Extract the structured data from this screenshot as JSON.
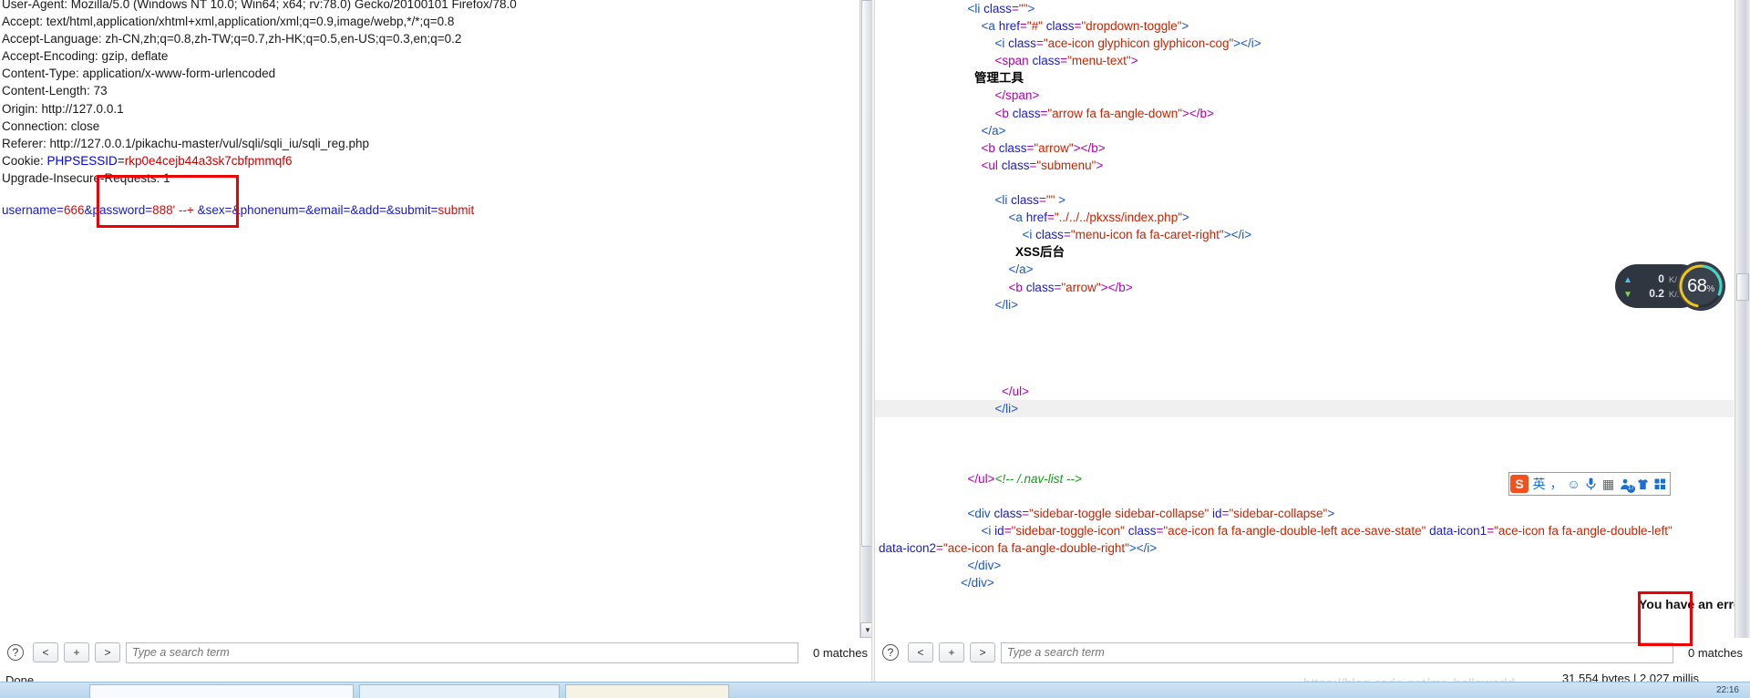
{
  "request": {
    "headers": [
      "User-Agent: Mozilla/5.0 (Windows NT 10.0; Win64; x64; rv:78.0) Gecko/20100101 Firefox/78.0",
      "Accept: text/html,application/xhtml+xml,application/xml;q=0.9,image/webp,*/*;q=0.8",
      "Accept-Language: zh-CN,zh;q=0.8,zh-TW;q=0.7,zh-HK;q=0.5,en-US;q=0.3,en;q=0.2",
      "Accept-Encoding: gzip, deflate",
      "Content-Type: application/x-www-form-urlencoded",
      "Content-Length: 73",
      "Origin: http://127.0.0.1",
      "Connection: close",
      "Referer: http://127.0.0.1/pikachu-master/vul/sqli/sqli_iu/sqli_reg.php"
    ],
    "cookie_label": "Cookie: ",
    "cookie_name": "PHPSESSID",
    "cookie_eq": "=",
    "cookie_value": "rkp0e4cejb44a3sk7cbfpmmqf6",
    "upgrade_header": "Upgrade-Insecure-Requests: 1",
    "post_body": [
      {
        "text": "username",
        "color": "blue"
      },
      {
        "text": "=",
        "color": "blue"
      },
      {
        "text": "666",
        "color": "red"
      },
      {
        "text": "&",
        "color": "blue"
      },
      {
        "text": "password",
        "color": "blue"
      },
      {
        "text": "=",
        "color": "blue"
      },
      {
        "text": "888' --+ ",
        "color": "red"
      },
      {
        "text": "&",
        "color": "blue"
      },
      {
        "text": "sex",
        "color": "blue"
      },
      {
        "text": "=&",
        "color": "blue"
      },
      {
        "text": "phonenum",
        "color": "blue"
      },
      {
        "text": "=&",
        "color": "blue"
      },
      {
        "text": "email",
        "color": "blue"
      },
      {
        "text": "=&",
        "color": "blue"
      },
      {
        "text": "add",
        "color": "blue"
      },
      {
        "text": "=&",
        "color": "blue"
      },
      {
        "text": "submit",
        "color": "blue"
      },
      {
        "text": "=",
        "color": "blue"
      },
      {
        "text": "submit",
        "color": "red"
      }
    ],
    "status": "Done",
    "search": {
      "placeholder": "Type a search term",
      "value": "",
      "matches": "0 matches",
      "help": "?",
      "prev": "<",
      "add": "+",
      "next": ">"
    }
  },
  "response": {
    "code_lines": [
      {
        "indent": 13,
        "shaded": false,
        "tokens": [
          {
            "t": "<li ",
            "c": "tag"
          },
          {
            "t": "class",
            "c": "attr"
          },
          {
            "t": "=",
            "c": "punct"
          },
          {
            "t": "\"\"",
            "c": "val"
          },
          {
            "t": ">",
            "c": "tag"
          }
        ]
      },
      {
        "indent": 15,
        "shaded": false,
        "tokens": [
          {
            "t": "<a ",
            "c": "tag"
          },
          {
            "t": "href",
            "c": "attr"
          },
          {
            "t": "=",
            "c": "punct"
          },
          {
            "t": "\"#\"",
            "c": "val"
          },
          {
            "t": " class",
            "c": "attr"
          },
          {
            "t": "=",
            "c": "punct"
          },
          {
            "t": "\"dropdown-toggle\"",
            "c": "val"
          },
          {
            "t": ">",
            "c": "tag"
          }
        ]
      },
      {
        "indent": 17,
        "shaded": false,
        "tokens": [
          {
            "t": "<i ",
            "c": "tag"
          },
          {
            "t": "class",
            "c": "attr"
          },
          {
            "t": "=",
            "c": "punct"
          },
          {
            "t": "\"ace-icon glyphicon glyphicon-cog\"",
            "c": "val"
          },
          {
            "t": "></i>",
            "c": "tag"
          }
        ]
      },
      {
        "indent": 17,
        "shaded": false,
        "tokens": [
          {
            "t": "<span ",
            "c": "punct"
          },
          {
            "t": "class",
            "c": "attr"
          },
          {
            "t": "=",
            "c": "punct"
          },
          {
            "t": "\"menu-text\"",
            "c": "val"
          },
          {
            "t": ">",
            "c": "punct"
          }
        ]
      },
      {
        "indent": 14,
        "shaded": false,
        "tokens": [
          {
            "t": "管理工具",
            "c": "text"
          }
        ]
      },
      {
        "indent": 17,
        "shaded": false,
        "tokens": [
          {
            "t": "</span>",
            "c": "punct"
          }
        ]
      },
      {
        "indent": 17,
        "shaded": false,
        "tokens": [
          {
            "t": "<b ",
            "c": "punct"
          },
          {
            "t": "class",
            "c": "attr"
          },
          {
            "t": "=",
            "c": "punct"
          },
          {
            "t": "\"arrow fa fa-angle-down\"",
            "c": "val"
          },
          {
            "t": "></b>",
            "c": "punct"
          }
        ]
      },
      {
        "indent": 15,
        "shaded": false,
        "tokens": [
          {
            "t": "</a>",
            "c": "tag"
          }
        ]
      },
      {
        "indent": 15,
        "shaded": false,
        "tokens": [
          {
            "t": "<b ",
            "c": "punct"
          },
          {
            "t": "class",
            "c": "attr"
          },
          {
            "t": "=",
            "c": "punct"
          },
          {
            "t": "\"arrow\"",
            "c": "val"
          },
          {
            "t": "></b>",
            "c": "punct"
          }
        ]
      },
      {
        "indent": 15,
        "shaded": false,
        "tokens": [
          {
            "t": "<ul ",
            "c": "punct"
          },
          {
            "t": "class",
            "c": "attr"
          },
          {
            "t": "=",
            "c": "punct"
          },
          {
            "t": "\"submenu\"",
            "c": "val"
          },
          {
            "t": ">",
            "c": "punct"
          }
        ]
      },
      {
        "indent": 0,
        "shaded": false,
        "tokens": []
      },
      {
        "indent": 17,
        "shaded": false,
        "tokens": [
          {
            "t": "<li ",
            "c": "tag"
          },
          {
            "t": "class",
            "c": "attr"
          },
          {
            "t": "=",
            "c": "punct"
          },
          {
            "t": "\"\"",
            "c": "val"
          },
          {
            "t": " >",
            "c": "tag"
          }
        ]
      },
      {
        "indent": 19,
        "shaded": false,
        "tokens": [
          {
            "t": "<a ",
            "c": "tag"
          },
          {
            "t": "href",
            "c": "attr"
          },
          {
            "t": "=",
            "c": "punct"
          },
          {
            "t": "\"../../../pkxss/index.php\"",
            "c": "val"
          },
          {
            "t": ">",
            "c": "tag"
          }
        ]
      },
      {
        "indent": 21,
        "shaded": false,
        "tokens": [
          {
            "t": "<i ",
            "c": "tag"
          },
          {
            "t": "class",
            "c": "attr"
          },
          {
            "t": "=",
            "c": "punct"
          },
          {
            "t": "\"menu-icon fa fa-caret-right\"",
            "c": "val"
          },
          {
            "t": "></i>",
            "c": "tag"
          }
        ]
      },
      {
        "indent": 20,
        "shaded": false,
        "tokens": [
          {
            "t": "XSS后台",
            "c": "text"
          }
        ]
      },
      {
        "indent": 19,
        "shaded": false,
        "tokens": [
          {
            "t": "</a>",
            "c": "tag"
          }
        ]
      },
      {
        "indent": 19,
        "shaded": false,
        "tokens": [
          {
            "t": "<b ",
            "c": "punct"
          },
          {
            "t": "class",
            "c": "attr"
          },
          {
            "t": "=",
            "c": "punct"
          },
          {
            "t": "\"arrow\"",
            "c": "val"
          },
          {
            "t": "></b>",
            "c": "punct"
          }
        ]
      },
      {
        "indent": 17,
        "shaded": false,
        "tokens": [
          {
            "t": "</li>",
            "c": "tag"
          }
        ]
      },
      {
        "indent": 0,
        "shaded": false,
        "tokens": []
      },
      {
        "indent": 0,
        "shaded": false,
        "tokens": []
      },
      {
        "indent": 0,
        "shaded": false,
        "tokens": []
      },
      {
        "indent": 0,
        "shaded": false,
        "tokens": []
      },
      {
        "indent": 18,
        "shaded": false,
        "tokens": [
          {
            "t": "</ul>",
            "c": "punct"
          }
        ]
      },
      {
        "indent": 17,
        "shaded": true,
        "tokens": [
          {
            "t": "</li>",
            "c": "tag"
          }
        ]
      },
      {
        "indent": 0,
        "shaded": false,
        "tokens": []
      },
      {
        "indent": 0,
        "shaded": false,
        "tokens": []
      },
      {
        "indent": 0,
        "shaded": false,
        "tokens": []
      },
      {
        "indent": 13,
        "shaded": false,
        "tokens": [
          {
            "t": "</ul>",
            "c": "punct"
          },
          {
            "t": "<!-- /.nav-list -->",
            "c": "comment"
          }
        ]
      },
      {
        "indent": 0,
        "shaded": false,
        "tokens": []
      },
      {
        "indent": 13,
        "shaded": false,
        "tokens": [
          {
            "t": "<div ",
            "c": "tag"
          },
          {
            "t": "class",
            "c": "attr"
          },
          {
            "t": "=",
            "c": "punct"
          },
          {
            "t": "\"sidebar-toggle sidebar-collapse\"",
            "c": "val"
          },
          {
            "t": " id",
            "c": "attr"
          },
          {
            "t": "=",
            "c": "punct"
          },
          {
            "t": "\"sidebar-collapse\"",
            "c": "val"
          },
          {
            "t": ">",
            "c": "tag"
          }
        ]
      },
      {
        "indent": 15,
        "shaded": false,
        "tokens": [
          {
            "t": "<i ",
            "c": "tag"
          },
          {
            "t": "id",
            "c": "attr"
          },
          {
            "t": "=",
            "c": "punct"
          },
          {
            "t": "\"sidebar-toggle-icon\"",
            "c": "val"
          },
          {
            "t": " class",
            "c": "attr"
          },
          {
            "t": "=",
            "c": "punct"
          },
          {
            "t": "\"ace-icon fa fa-angle-double-left ace-save-state\"",
            "c": "val"
          },
          {
            "t": " data-icon1",
            "c": "attr"
          },
          {
            "t": "=",
            "c": "punct"
          },
          {
            "t": "\"ace-icon fa fa-angle-double-left\"",
            "c": "val"
          }
        ]
      },
      {
        "indent": 0,
        "shaded": false,
        "tokens": [
          {
            "t": "data-icon2",
            "c": "attr"
          },
          {
            "t": "=",
            "c": "punct"
          },
          {
            "t": "\"ace-icon fa fa-angle-double-right\"",
            "c": "val"
          },
          {
            "t": "></i>",
            "c": "tag"
          }
        ]
      },
      {
        "indent": 13,
        "shaded": false,
        "tokens": [
          {
            "t": "</div>",
            "c": "tag"
          }
        ]
      },
      {
        "indent": 12,
        "shaded": false,
        "tokens": [
          {
            "t": "</div>",
            "c": "tag"
          }
        ]
      }
    ],
    "sql_error": "You have an error in your SQL syntax; check the manual that corresponds to your MySQL server version for the right syntax to use near '' at line 1",
    "status": "31,554 bytes | 2,027 millis",
    "search": {
      "placeholder": "Type a search term",
      "value": "",
      "matches": "0 matches",
      "help": "?",
      "prev": "<",
      "add": "+",
      "next": ">"
    }
  },
  "net_widget": {
    "upload": "0",
    "upload_unit": "K/s",
    "download": "0.2",
    "download_unit": "K/s",
    "cpu": "68",
    "cpu_unit": "%"
  },
  "ime_bar": {
    "logo": "S",
    "mode": "英",
    "punct": "，",
    "emoji": "☺",
    "mic": "🎙",
    "keyboard": "▦",
    "calendar": "17",
    "skin": "👕",
    "apps": "▤"
  },
  "watermark": "https://blog.csdn.net/mr_helloworld",
  "taskbar": {
    "clock": "22:16"
  },
  "colors": {
    "annotation": "#ee0000",
    "link": "#0000ee",
    "value": "#cc0000",
    "accent": "#1a6fd4"
  }
}
